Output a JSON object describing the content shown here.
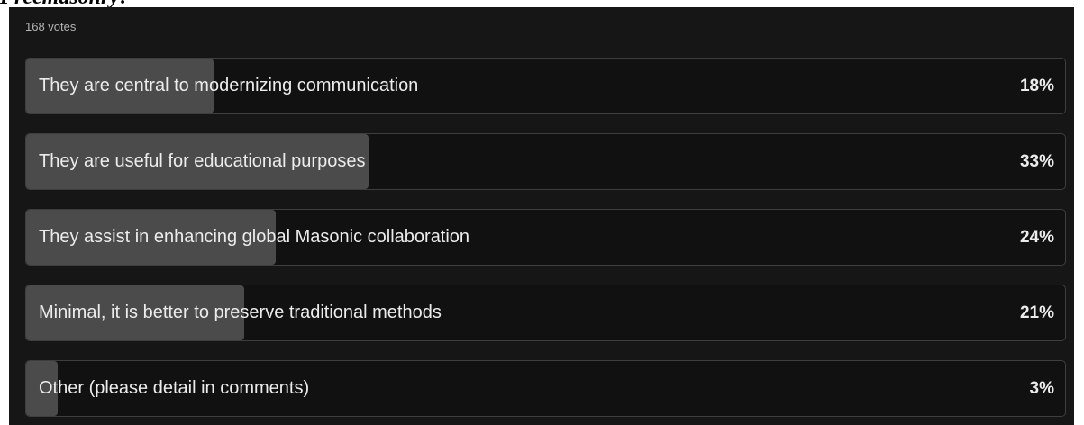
{
  "page": {
    "heading_fragment": "Freemasonry?"
  },
  "poll": {
    "vote_count": "168 votes",
    "options": [
      {
        "label": "They are central to modernizing communication",
        "percent_text": "18%",
        "percent": 18
      },
      {
        "label": "They are useful for educational purposes",
        "percent_text": "33%",
        "percent": 33
      },
      {
        "label": "They assist in enhancing global Masonic collaboration",
        "percent_text": "24%",
        "percent": 24
      },
      {
        "label": "Minimal, it is better to preserve traditional methods",
        "percent_text": "21%",
        "percent": 21
      },
      {
        "label": "Other (please detail in comments)",
        "percent_text": "3%",
        "percent": 3
      }
    ]
  },
  "colors": {
    "panel_background": "#161616",
    "option_background": "#111111",
    "option_border": "#3e3e3e",
    "result_fill": "#4b4b4b",
    "text": "#ececec",
    "muted_text": "#b3b3b3"
  }
}
